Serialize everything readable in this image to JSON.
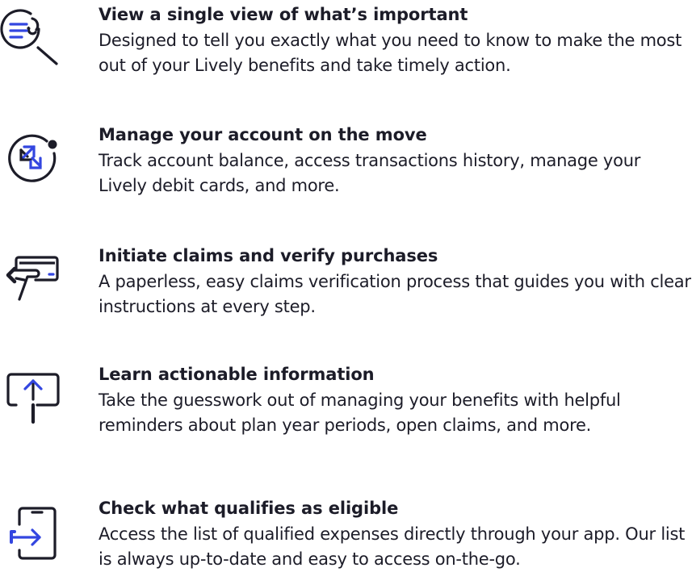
{
  "colors": {
    "text": "#1c1c28",
    "accent": "#3346e0"
  },
  "features": [
    {
      "icon": "document-search-icon",
      "title": "View a single view of what’s important",
      "description": "Designed to tell you exactly what you need to know to make the most out of your Lively benefits and take timely action."
    },
    {
      "icon": "account-transfer-icon",
      "title": "Manage your account on the move",
      "description": "Track account balance, access transactions history, manage your Lively debit cards, and more."
    },
    {
      "icon": "card-claim-icon",
      "title": "Initiate claims and verify purchases",
      "description": "A paperless, easy claims verification process that guides you with clear instructions at every step."
    },
    {
      "icon": "upload-info-icon",
      "title": "Learn actionable information",
      "description": "Take the guesswork out of managing your benefits with helpful reminders about plan year periods, open claims, and more."
    },
    {
      "icon": "phone-eligible-icon",
      "title": "Check what qualifies as eligible",
      "description": "Access the list of qualified expenses directly through your app. Our list is always up-to-date and easy to access on-the-go."
    }
  ]
}
